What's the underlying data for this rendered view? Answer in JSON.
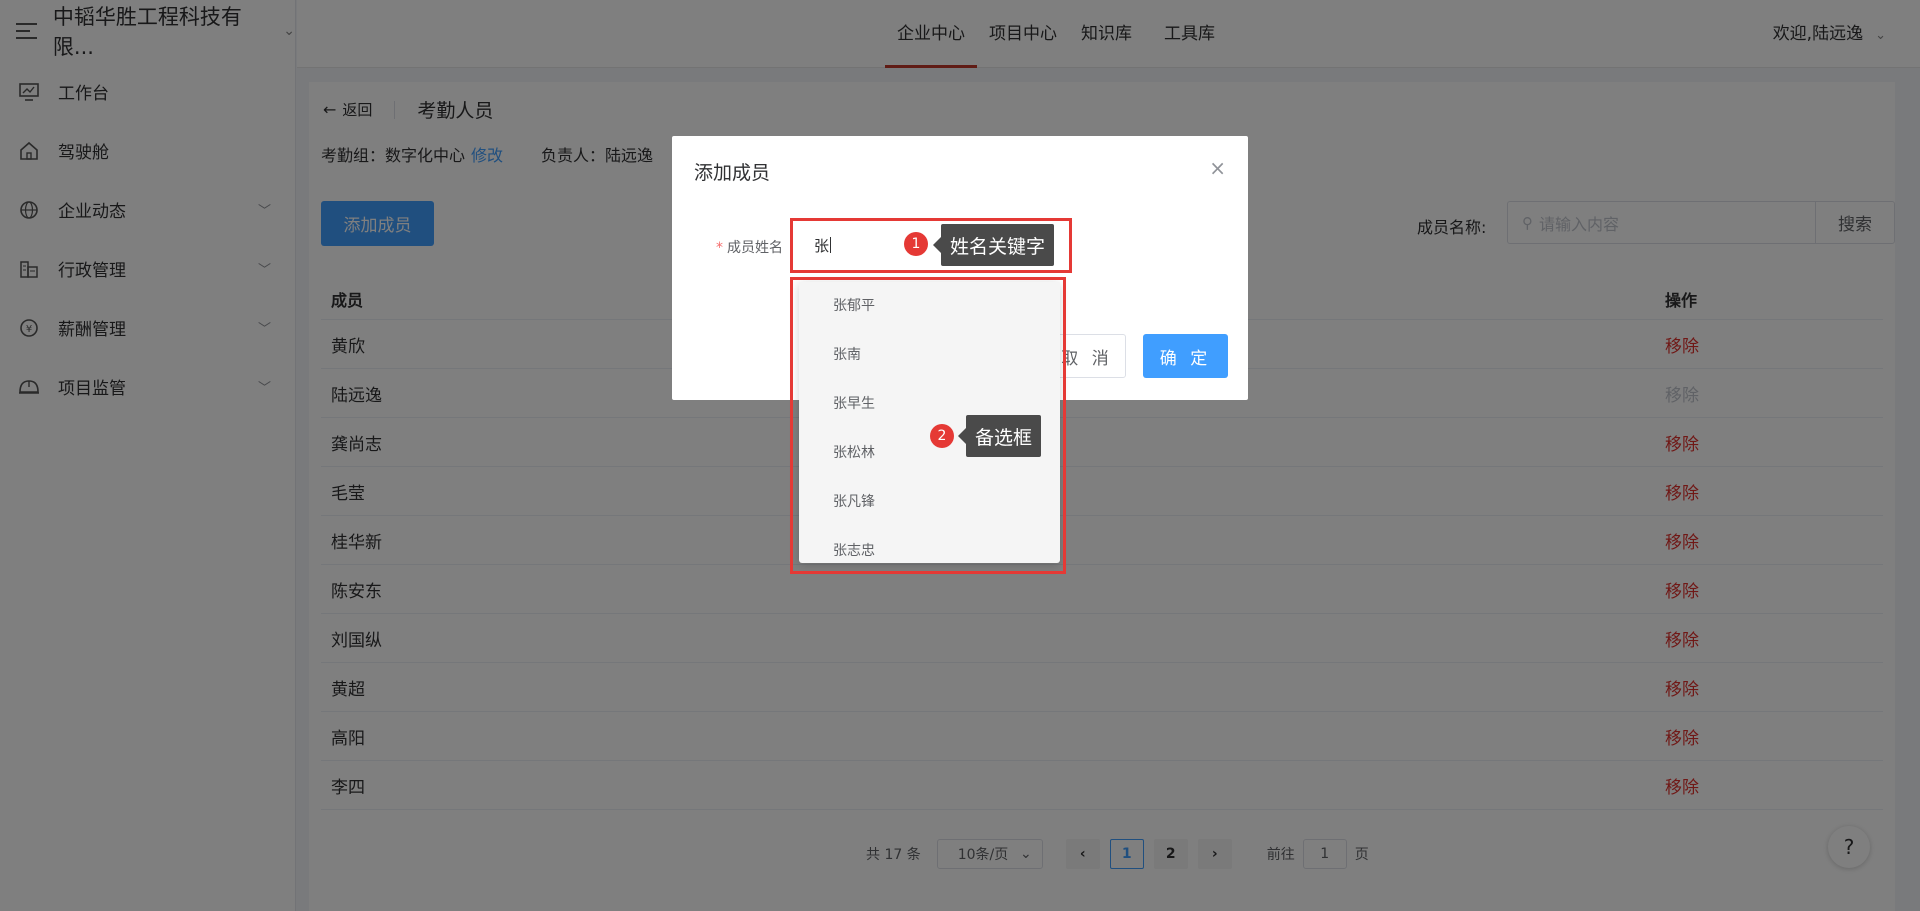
{
  "sidebar": {
    "company": "中韬华胜工程科技有限...",
    "items": [
      {
        "label": "工作台",
        "has_arrow": false
      },
      {
        "label": "驾驶舱",
        "has_arrow": false
      },
      {
        "label": "企业动态",
        "has_arrow": true
      },
      {
        "label": "行政管理",
        "has_arrow": true
      },
      {
        "label": "薪酬管理",
        "has_arrow": true
      },
      {
        "label": "项目监管",
        "has_arrow": true
      }
    ]
  },
  "topbar": {
    "tabs": [
      "企业中心",
      "项目中心",
      "知识库",
      "工具库"
    ],
    "active_tab": "企业中心",
    "welcome": "欢迎,陆远逸"
  },
  "page": {
    "back_label": "返回",
    "title": "考勤人员",
    "group_label": "考勤组：数字化中心",
    "modify_link": "修改",
    "owner_label": "负责人：陆远逸",
    "add_button": "添加成员",
    "search_label": "成员名称:",
    "search_placeholder": "请输入内容",
    "search_button": "搜索"
  },
  "table": {
    "headers": [
      "成员",
      "操作"
    ],
    "rows": [
      {
        "name": "黄欣",
        "action": "移除",
        "disabled": false
      },
      {
        "name": "陆远逸",
        "action": "移除",
        "disabled": true
      },
      {
        "name": "龚尚志",
        "action": "移除",
        "disabled": false
      },
      {
        "name": "毛莹",
        "action": "移除",
        "disabled": false
      },
      {
        "name": "桂华新",
        "action": "移除",
        "disabled": false
      },
      {
        "name": "陈安东",
        "action": "移除",
        "disabled": false
      },
      {
        "name": "刘国纵",
        "action": "移除",
        "disabled": false
      },
      {
        "name": "黄超",
        "action": "移除",
        "disabled": false
      },
      {
        "name": "高阳",
        "action": "移除",
        "disabled": false
      },
      {
        "name": "李四",
        "action": "移除",
        "disabled": false
      }
    ]
  },
  "pagination": {
    "total": "共 17 条",
    "page_size": "10条/页",
    "pages": [
      "1",
      "2"
    ],
    "current": "1",
    "goto_prefix": "前往",
    "goto_value": "1",
    "goto_suffix": "页"
  },
  "help": "?",
  "dialog": {
    "title": "添加成员",
    "field_label": "成员姓名",
    "field_value": "张",
    "cancel": "取 消",
    "confirm": "确 定",
    "close": "×"
  },
  "dropdown": {
    "options": [
      "张郁平",
      "张南",
      "张早生",
      "张松林",
      "张凡锋",
      "张志忠"
    ]
  },
  "annotations": [
    {
      "number": "1",
      "text": "姓名关键字"
    },
    {
      "number": "2",
      "text": "备选框"
    }
  ],
  "colors": {
    "primary": "#409eff",
    "danger": "#e0302d",
    "annotation": "#e53935",
    "active_tab_underline": "#c0392b"
  }
}
